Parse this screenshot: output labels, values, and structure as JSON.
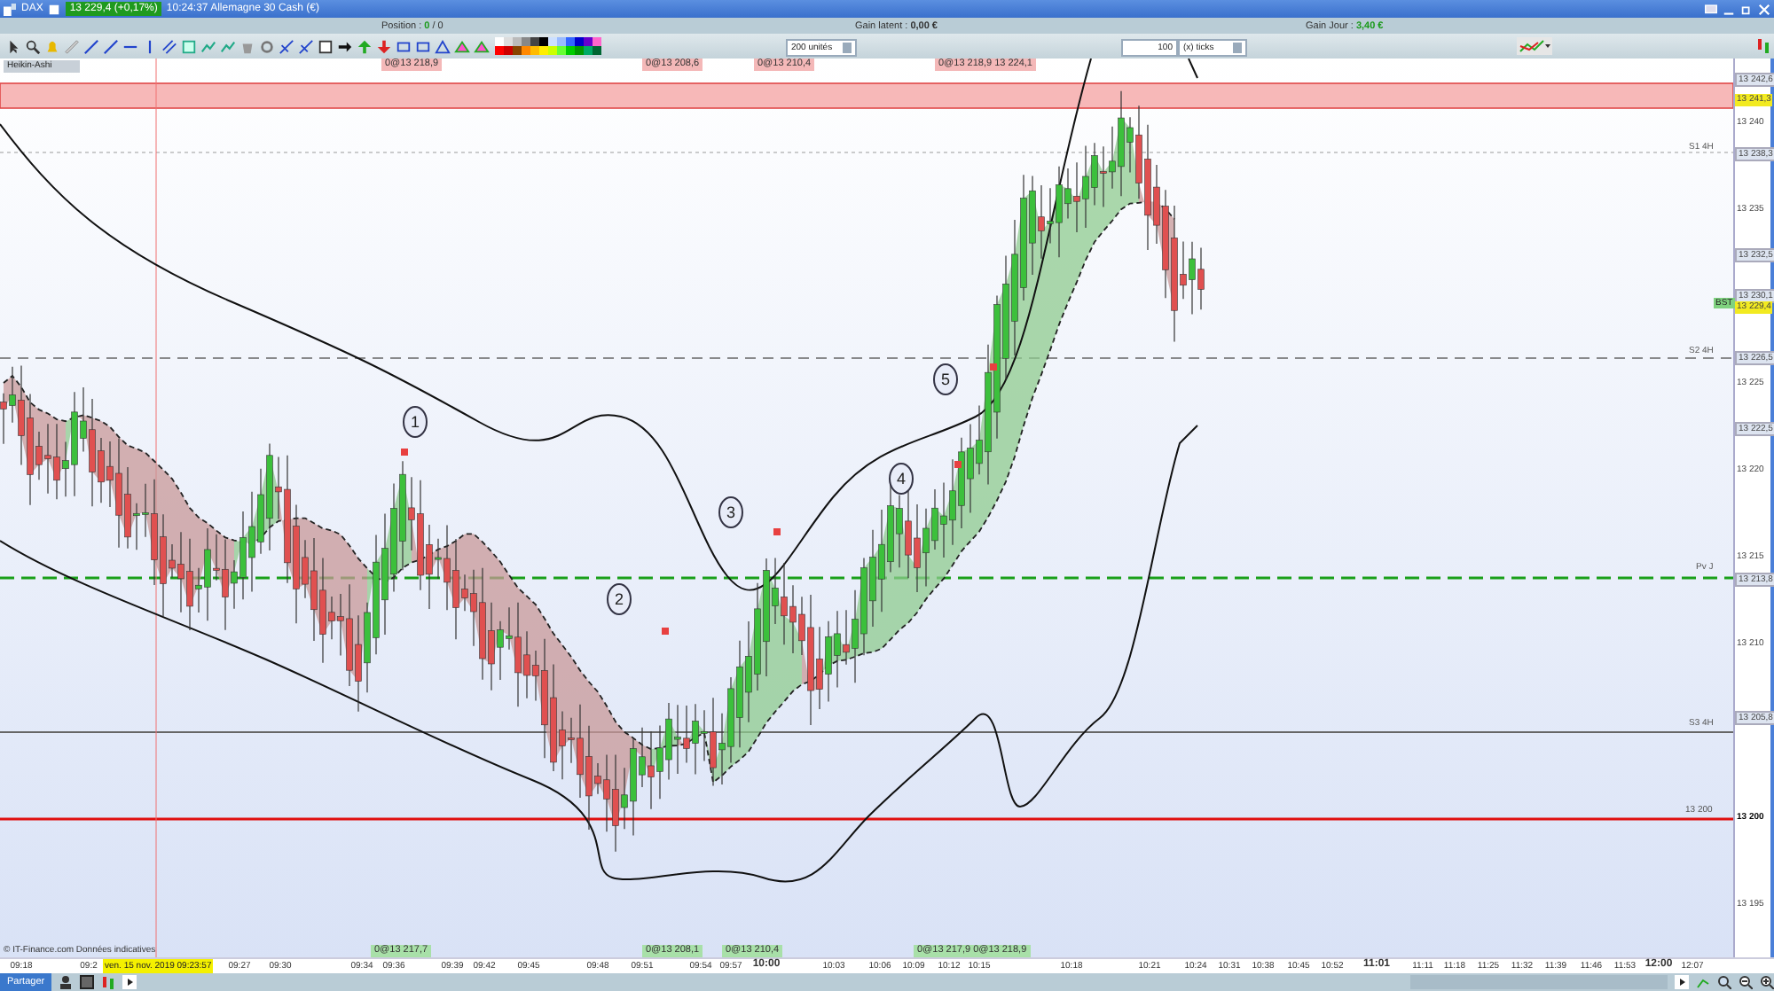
{
  "window": {
    "instrument": "DAX",
    "quote": "13 229,4 (+0,17%)",
    "title": "10:24:37 Allemagne 30 Cash (€)"
  },
  "info_bar": {
    "position_label": "Position :",
    "position_value": "0",
    "position_total": "/ 0",
    "unrealized_label": "Gain latent :",
    "unrealized_value": "0,00 €",
    "day_label": "Gain Jour :",
    "day_value": "3,40 €"
  },
  "toolbar": {
    "quantity": "200 unités",
    "ticks_value": "100",
    "ticks_unit": "(x) ticks"
  },
  "chart": {
    "indicator": "Heikin-Ashi",
    "price_labels": [
      {
        "text": "13 242,6",
        "kind": "box"
      },
      {
        "text": "13 241,3",
        "kind": "highlight"
      },
      {
        "text": "13 240",
        "kind": "plain"
      },
      {
        "text": "13 238,3",
        "kind": "box"
      },
      {
        "text": "13 235",
        "kind": "plain"
      },
      {
        "text": "13 232,5",
        "kind": "box"
      },
      {
        "text": "13 230,1",
        "kind": "box"
      },
      {
        "text": "13 229,4",
        "kind": "highlight"
      },
      {
        "text": "13 226,5",
        "kind": "box"
      },
      {
        "text": "13 225",
        "kind": "plain"
      },
      {
        "text": "13 222,5",
        "kind": "box"
      },
      {
        "text": "13 220",
        "kind": "plain"
      },
      {
        "text": "13 215",
        "kind": "plain"
      },
      {
        "text": "13 213,8",
        "kind": "box"
      },
      {
        "text": "13 210",
        "kind": "plain"
      },
      {
        "text": "13 205,8",
        "kind": "box"
      },
      {
        "text": "13 200",
        "kind": "bold"
      },
      {
        "text": "13 195",
        "kind": "plain"
      }
    ],
    "axis_tag": "BST",
    "level_labels": [
      "S1 4H",
      "S2 4H",
      "Pv J",
      "S3 4H",
      "13 200"
    ],
    "top_orders": [
      "0@13 218,9",
      "0@13 208,6",
      "0@13 210,4",
      "0@13 218,9 13 224,1"
    ],
    "bottom_orders": [
      "0@13 217,7",
      "0@13 208,1",
      "0@13 210,4",
      "0@13 217,9 0@13 218,9"
    ],
    "waves": [
      "1",
      "2",
      "3",
      "4",
      "5"
    ],
    "source": "© IT-Finance.com Données indicatives",
    "cursor_date": "ven. 15 nov. 2019 09:23:57",
    "time_labels": [
      {
        "text": "09:18",
        "bold": false
      },
      {
        "text": "09:2",
        "bold": false
      },
      {
        "text": "09:27",
        "bold": false
      },
      {
        "text": "09:30",
        "bold": false
      },
      {
        "text": "09:34",
        "bold": false
      },
      {
        "text": "09:36",
        "bold": false
      },
      {
        "text": "09:39",
        "bold": false
      },
      {
        "text": "09:42",
        "bold": false
      },
      {
        "text": "09:45",
        "bold": false
      },
      {
        "text": "09:48",
        "bold": false
      },
      {
        "text": "09:51",
        "bold": false
      },
      {
        "text": "09:54",
        "bold": false
      },
      {
        "text": "09:57",
        "bold": false
      },
      {
        "text": "10:00",
        "bold": true
      },
      {
        "text": "10:03",
        "bold": false
      },
      {
        "text": "10:06",
        "bold": false
      },
      {
        "text": "10:09",
        "bold": false
      },
      {
        "text": "10:12",
        "bold": false
      },
      {
        "text": "10:15",
        "bold": false
      },
      {
        "text": "10:18",
        "bold": false
      },
      {
        "text": "10:21",
        "bold": false
      },
      {
        "text": "10:24",
        "bold": false
      },
      {
        "text": "10:31",
        "bold": false
      },
      {
        "text": "10:38",
        "bold": false
      },
      {
        "text": "10:45",
        "bold": false
      },
      {
        "text": "10:52",
        "bold": false
      },
      {
        "text": "11:01",
        "bold": true
      },
      {
        "text": "11:11",
        "bold": false
      },
      {
        "text": "11:18",
        "bold": false
      },
      {
        "text": "11:25",
        "bold": false
      },
      {
        "text": "11:32",
        "bold": false
      },
      {
        "text": "11:39",
        "bold": false
      },
      {
        "text": "11:46",
        "bold": false
      },
      {
        "text": "11:53",
        "bold": false
      },
      {
        "text": "12:00",
        "bold": true
      },
      {
        "text": "12:07",
        "bold": false
      }
    ]
  },
  "footer": {
    "share_button": "Partager"
  }
}
